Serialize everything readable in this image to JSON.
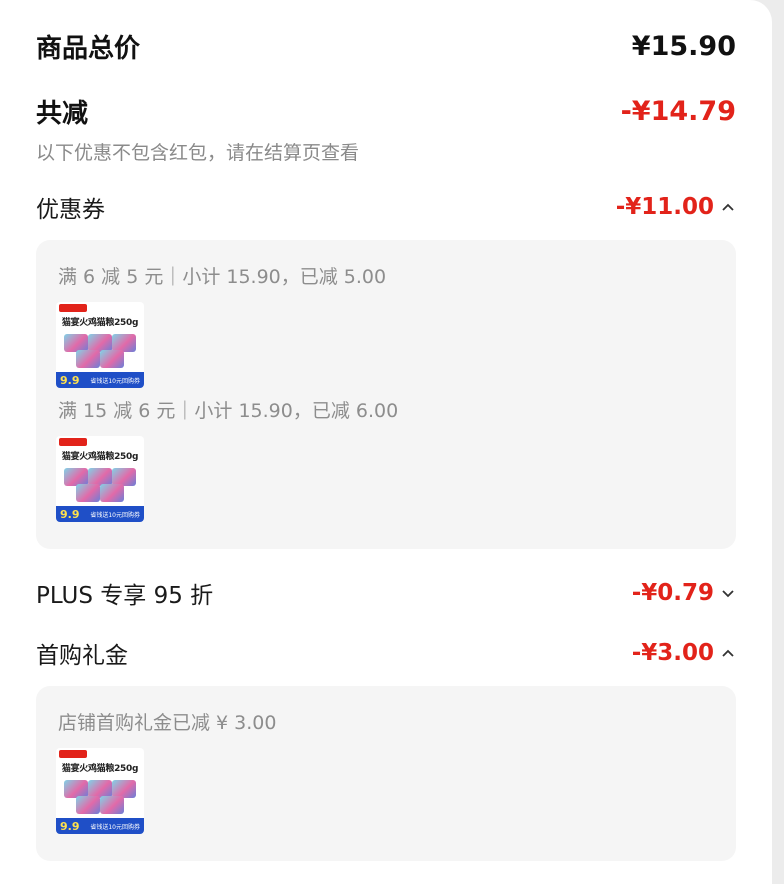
{
  "summary": {
    "total_label": "商品总价",
    "total_amount": "¥15.90",
    "discount_label": "共减",
    "discount_amount": "-¥14.79",
    "note": "以下优惠不包含红包，请在结算页查看"
  },
  "coupon": {
    "label": "优惠券",
    "amount": "-¥11.00",
    "expanded": true,
    "groups": [
      {
        "title": "满 6 减 5 元｜小计 15.90，已减 5.00"
      },
      {
        "title": "满 15 减 6 元｜小计 15.90，已减 6.00"
      }
    ]
  },
  "plus": {
    "label": "PLUS 专享 95 折",
    "amount": "-¥0.79",
    "expanded": false
  },
  "first_purchase": {
    "label": "首购礼金",
    "amount": "-¥3.00",
    "expanded": true,
    "detail": "店铺首购礼金已减 ¥ 3.00"
  },
  "product": {
    "name": "猫宴火鸡猫粮250g",
    "price": "9.9",
    "promo": "省钱送10元回购券"
  },
  "colors": {
    "accent_red": "#e2231a",
    "panel_bg": "#f5f5f5"
  }
}
